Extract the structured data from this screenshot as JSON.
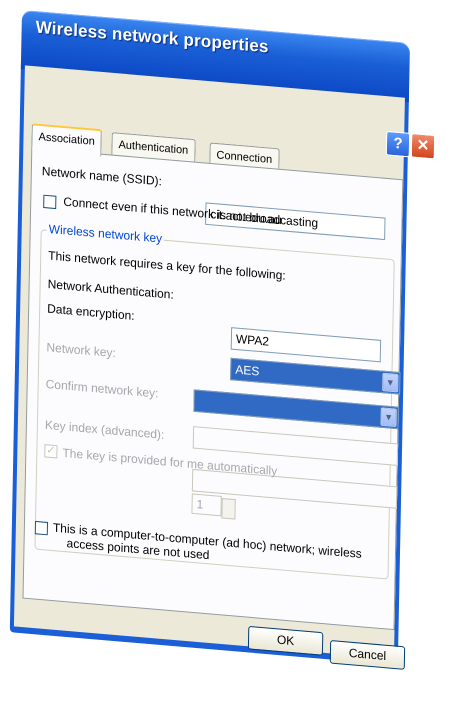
{
  "window": {
    "title": "Wireless network properties",
    "help_button": "?",
    "close_button": "✕"
  },
  "tabs": [
    {
      "label": "Association",
      "active": true
    },
    {
      "label": "Authentication",
      "active": false
    },
    {
      "label": "Connection",
      "active": false
    }
  ],
  "association": {
    "ssid_label": "Network name (SSID):",
    "ssid_value": "cit.act.edu.au",
    "connect_hidden_label": "Connect even if this network is not broadcasting",
    "connect_hidden_checked": false,
    "group_title": "Wireless network key",
    "requires_key_text": "This network requires a key for the following:",
    "network_auth_label": "Network Authentication:",
    "network_auth_value": "WPA2",
    "data_encryption_label": "Data encryption:",
    "data_encryption_value": "AES",
    "network_key_label": "Network key:",
    "network_key_value": "",
    "confirm_key_label": "Confirm network key:",
    "confirm_key_value": "",
    "key_index_label": "Key index (advanced):",
    "key_index_value": "1",
    "auto_key_label": "The key is provided for me automatically",
    "auto_key_checked": true,
    "adhoc_label_line1": "This is a computer-to-computer (ad hoc) network; wireless",
    "adhoc_label_line2": "access points are not used",
    "adhoc_checked": false
  },
  "buttons": {
    "ok": "OK",
    "cancel": "Cancel"
  },
  "colors": {
    "titlebar": "#0c47c4",
    "dialog_bg": "#ece9d8",
    "selection": "#316ac5",
    "group_title": "#0046d5"
  }
}
